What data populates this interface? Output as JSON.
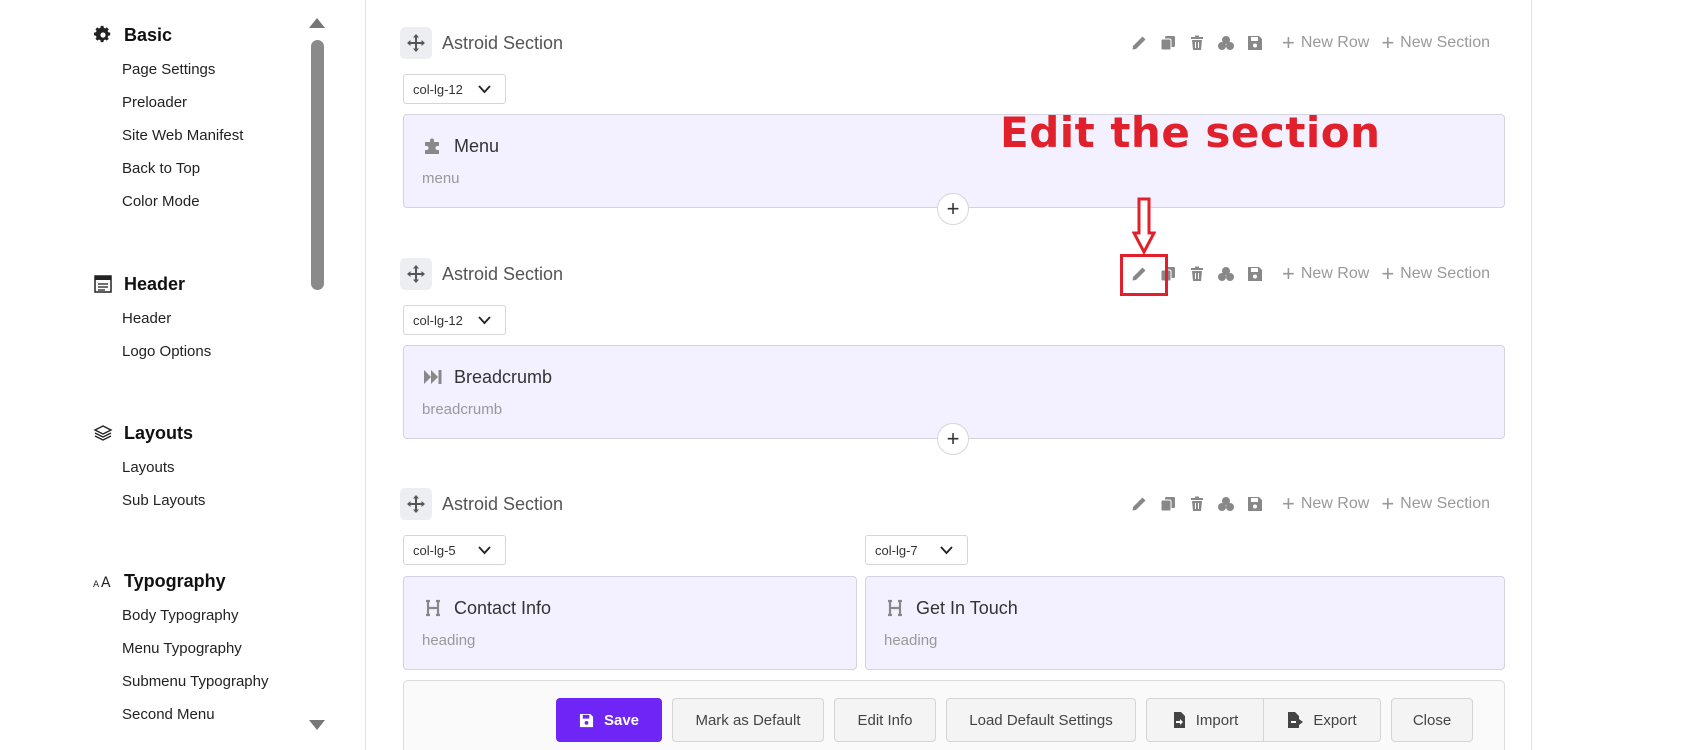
{
  "sidebar": {
    "groups": [
      {
        "title": "Basic",
        "icon": "gear-icon",
        "items": [
          "Page Settings",
          "Preloader",
          "Site Web Manifest",
          "Back to Top",
          "Color Mode"
        ]
      },
      {
        "title": "Header",
        "icon": "header-icon",
        "items": [
          "Header",
          "Logo Options"
        ]
      },
      {
        "title": "Layouts",
        "icon": "layers-icon",
        "items": [
          "Layouts",
          "Sub Layouts"
        ]
      },
      {
        "title": "Typography",
        "icon": "font-size-icon",
        "items": [
          "Body Typography",
          "Menu Typography",
          "Submenu Typography",
          "Second Menu"
        ]
      }
    ]
  },
  "sections": [
    {
      "title": "Astroid Section",
      "tools": {
        "new_row": "New Row",
        "new_section": "New Section"
      },
      "columns": [
        {
          "size": "col-lg-12",
          "element": {
            "title": "Menu",
            "type": "menu",
            "icon": "puzzle-icon"
          }
        }
      ]
    },
    {
      "title": "Astroid Section",
      "tools": {
        "new_row": "New Row",
        "new_section": "New Section"
      },
      "columns": [
        {
          "size": "col-lg-12",
          "element": {
            "title": "Breadcrumb",
            "type": "breadcrumb",
            "icon": "forward-step-icon"
          }
        }
      ]
    },
    {
      "title": "Astroid Section",
      "tools": {
        "new_row": "New Row",
        "new_section": "New Section"
      },
      "columns": [
        {
          "size": "col-lg-5",
          "element": {
            "title": "Contact Info",
            "type": "heading",
            "icon": "heading-icon"
          }
        },
        {
          "size": "col-lg-7",
          "element": {
            "title": "Get In Touch",
            "type": "heading",
            "icon": "heading-icon"
          }
        }
      ]
    }
  ],
  "annotation": {
    "text": "Edit the section",
    "color": "#e0202a"
  },
  "footer": {
    "save": "Save",
    "mark_default": "Mark as Default",
    "edit_info": "Edit Info",
    "load_default": "Load Default Settings",
    "import": "Import",
    "export": "Export",
    "close": "Close"
  },
  "colors": {
    "accent": "#6f25f5",
    "block_bg": "#f3f0ff"
  }
}
